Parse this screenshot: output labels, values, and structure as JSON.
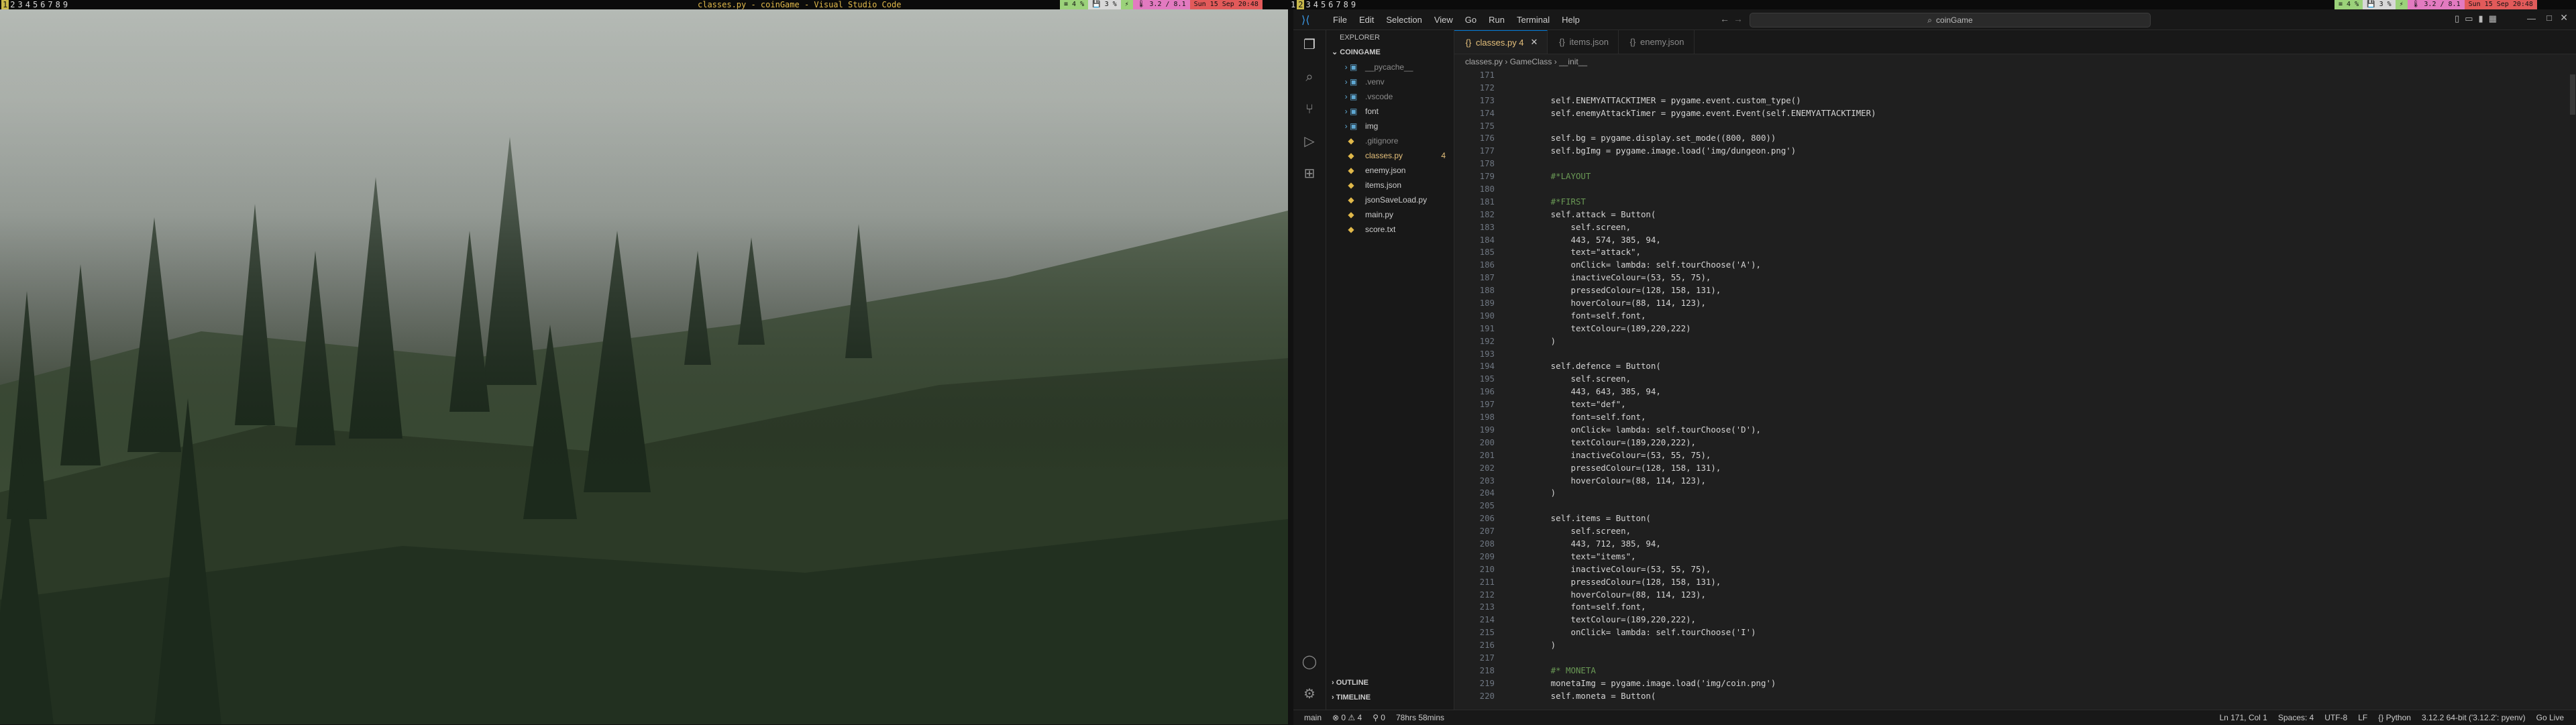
{
  "topbar": {
    "left_workspaces": [
      "1",
      "2",
      "3",
      "4",
      "5",
      "6",
      "7",
      "8",
      "9"
    ],
    "left_active": 0,
    "window_title": "classes.py - coinGame - Visual Studio Code",
    "right_workspaces": [
      "1",
      "2",
      "3",
      "4",
      "5",
      "6",
      "7",
      "8",
      "9"
    ],
    "right_active": 1,
    "modules": [
      {
        "label": "≡ 4 %",
        "color": "#9bd27a"
      },
      {
        "label": "💾 3 %",
        "color": "#d8d8d8"
      },
      {
        "label": "⚡",
        "color": "#9bd27a"
      },
      {
        "label": "🌡 3.2 / 8.1",
        "color": "#e27ac0"
      },
      {
        "label": "Sun 15 Sep 20:48",
        "color": "#e25a5a"
      }
    ]
  },
  "vscode": {
    "menu": [
      "File",
      "Edit",
      "Selection",
      "View",
      "Go",
      "Run",
      "Terminal",
      "Help"
    ],
    "search_text": "coinGame",
    "explorer_title": "EXPLORER",
    "project_name": "COINGAME",
    "files": [
      {
        "name": "__pycache__",
        "type": "folder",
        "color": "#8b8b8b"
      },
      {
        "name": ".venv",
        "type": "folder",
        "color": "#8b8b8b"
      },
      {
        "name": ".vscode",
        "type": "folder",
        "color": "#8b8b8b"
      },
      {
        "name": "font",
        "type": "folder",
        "color": "#ccc"
      },
      {
        "name": "img",
        "type": "folder",
        "color": "#ccc"
      },
      {
        "name": ".gitignore",
        "type": "file",
        "color": "#8b8b8b"
      },
      {
        "name": "classes.py",
        "type": "file",
        "color": "#e5c07b",
        "badge": "4"
      },
      {
        "name": "enemy.json",
        "type": "file",
        "color": "#ccc"
      },
      {
        "name": "items.json",
        "type": "file",
        "color": "#ccc"
      },
      {
        "name": "jsonSaveLoad.py",
        "type": "file",
        "color": "#ccc"
      },
      {
        "name": "main.py",
        "type": "file",
        "color": "#ccc"
      },
      {
        "name": "score.txt",
        "type": "file",
        "color": "#ccc"
      }
    ],
    "outline_label": "OUTLINE",
    "timeline_label": "TIMELINE",
    "tabs": [
      {
        "label": "classes.py 4",
        "active": true
      },
      {
        "label": "items.json",
        "active": false
      },
      {
        "label": "enemy.json",
        "active": false
      }
    ],
    "breadcrumbs": [
      "classes.py",
      "GameClass",
      "__init__"
    ],
    "code_lines": [
      {
        "n": "171",
        "t": ""
      },
      {
        "n": "172",
        "t": ""
      },
      {
        "n": "173",
        "t": "        self.ENEMYATTACKTIMER = pygame.event.custom_type()"
      },
      {
        "n": "174",
        "t": "        self.enemyAttackTimer = pygame.event.Event(self.ENEMYATTACKTIMER)"
      },
      {
        "n": "175",
        "t": ""
      },
      {
        "n": "176",
        "t": "        self.bg = pygame.display.set_mode((800, 800))"
      },
      {
        "n": "177",
        "t": "        self.bgImg = pygame.image.load('img/dungeon.png')"
      },
      {
        "n": "178",
        "t": ""
      },
      {
        "n": "179",
        "t": "        #*LAYOUT"
      },
      {
        "n": "180",
        "t": ""
      },
      {
        "n": "181",
        "t": "        #*FIRST"
      },
      {
        "n": "182",
        "t": "        self.attack = Button("
      },
      {
        "n": "183",
        "t": "            self.screen,"
      },
      {
        "n": "184",
        "t": "            443, 574, 385, 94,"
      },
      {
        "n": "185",
        "t": "            text=\"attack\","
      },
      {
        "n": "186",
        "t": "            onClick= lambda: self.tourChoose('A'),"
      },
      {
        "n": "187",
        "t": "            inactiveColour=(53, 55, 75),"
      },
      {
        "n": "188",
        "t": "            pressedColour=(128, 158, 131),"
      },
      {
        "n": "189",
        "t": "            hoverColour=(88, 114, 123),"
      },
      {
        "n": "190",
        "t": "            font=self.font,"
      },
      {
        "n": "191",
        "t": "            textColour=(189,220,222)"
      },
      {
        "n": "192",
        "t": "        )"
      },
      {
        "n": "193",
        "t": ""
      },
      {
        "n": "194",
        "t": "        self.defence = Button("
      },
      {
        "n": "195",
        "t": "            self.screen,"
      },
      {
        "n": "196",
        "t": "            443, 643, 385, 94,"
      },
      {
        "n": "197",
        "t": "            text=\"def\","
      },
      {
        "n": "198",
        "t": "            font=self.font,"
      },
      {
        "n": "199",
        "t": "            onClick= lambda: self.tourChoose('D'),"
      },
      {
        "n": "200",
        "t": "            textColour=(189,220,222),"
      },
      {
        "n": "201",
        "t": "            inactiveColour=(53, 55, 75),"
      },
      {
        "n": "202",
        "t": "            pressedColour=(128, 158, 131),"
      },
      {
        "n": "203",
        "t": "            hoverColour=(88, 114, 123),"
      },
      {
        "n": "204",
        "t": "        )"
      },
      {
        "n": "205",
        "t": ""
      },
      {
        "n": "206",
        "t": "        self.items = Button("
      },
      {
        "n": "207",
        "t": "            self.screen,"
      },
      {
        "n": "208",
        "t": "            443, 712, 385, 94,"
      },
      {
        "n": "209",
        "t": "            text=\"items\","
      },
      {
        "n": "210",
        "t": "            inactiveColour=(53, 55, 75),"
      },
      {
        "n": "211",
        "t": "            pressedColour=(128, 158, 131),"
      },
      {
        "n": "212",
        "t": "            hoverColour=(88, 114, 123),"
      },
      {
        "n": "213",
        "t": "            font=self.font,"
      },
      {
        "n": "214",
        "t": "            textColour=(189,220,222),"
      },
      {
        "n": "215",
        "t": "            onClick= lambda: self.tourChoose('I')"
      },
      {
        "n": "216",
        "t": "        )"
      },
      {
        "n": "217",
        "t": ""
      },
      {
        "n": "218",
        "t": "        #* MONETA"
      },
      {
        "n": "219",
        "t": "        monetaImg = pygame.image.load('img/coin.png')"
      },
      {
        "n": "220",
        "t": "        self.moneta = Button("
      }
    ],
    "status_left": [
      "main",
      "⊗ 0 ⚠ 4",
      "⚲ 0",
      "78hrs 58mins"
    ],
    "status_right": [
      "Ln 171, Col 1",
      "Spaces: 4",
      "UTF-8",
      "LF",
      "{} Python",
      "3.12.2 64-bit ('3.12.2': pyenv)",
      "Go Live"
    ]
  }
}
